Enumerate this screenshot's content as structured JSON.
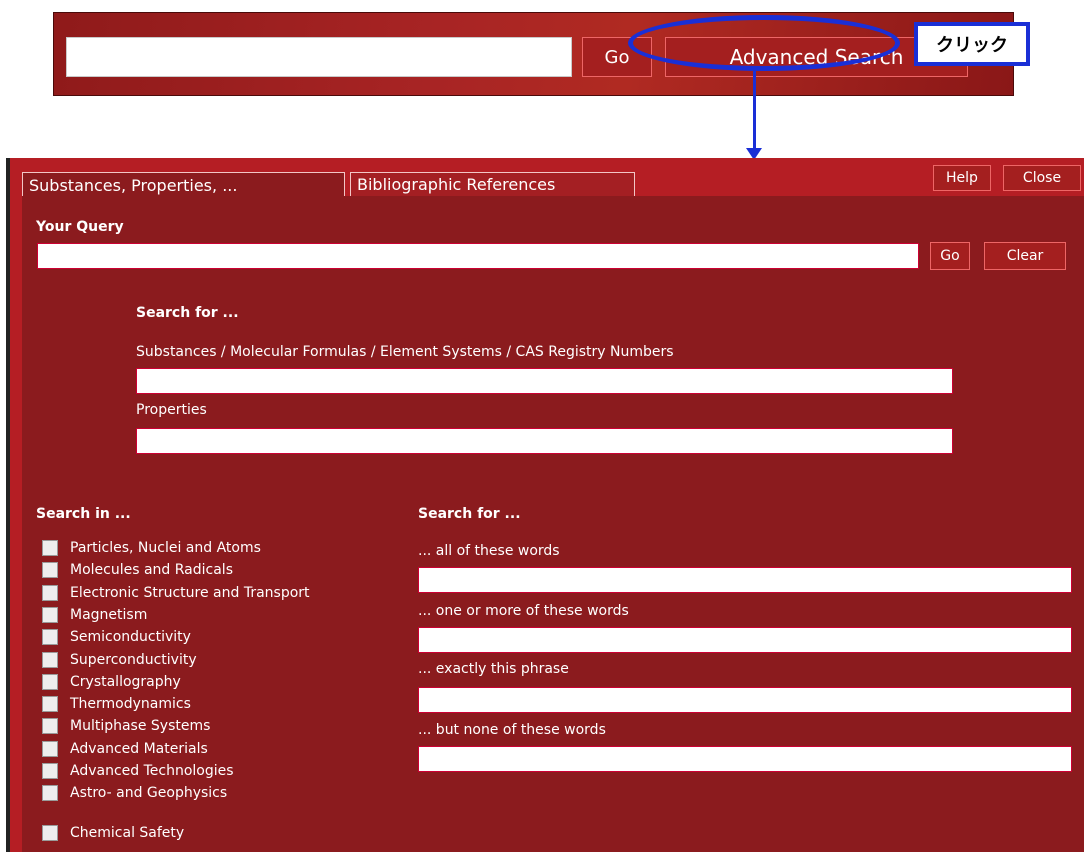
{
  "topbar": {
    "go_label": "Go",
    "advanced_label": "Advanced Search",
    "callout_text": "クリック"
  },
  "panel": {
    "tabs": [
      {
        "label": "Substances, Properties, ..."
      },
      {
        "label": "Bibliographic References"
      }
    ],
    "help_label": "Help",
    "close_label": "Close",
    "your_query_label": "Your Query",
    "query_go_label": "Go",
    "query_clear_label": "Clear",
    "search_for_title": "Search for ...",
    "substances_label": "Substances / Molecular Formulas / Element Systems / CAS Registry Numbers",
    "properties_label": "Properties",
    "search_in_title": "Search in ...",
    "search_for_title_2": "Search for ...",
    "word_fields": [
      {
        "label": "... all of these words"
      },
      {
        "label": "... one or more of these words"
      },
      {
        "label": "... exactly this phrase"
      },
      {
        "label": "... but none of these words"
      }
    ],
    "categories": [
      "Particles, Nuclei and Atoms",
      "Molecules and Radicals",
      "Electronic Structure and Transport",
      "Magnetism",
      "Semiconductivity",
      "Superconductivity",
      "Crystallography",
      "Thermodynamics",
      "Multiphase Systems",
      "Advanced Materials",
      "Advanced Technologies",
      "Astro- and Geophysics"
    ],
    "extra_category": "Chemical Safety"
  },
  "colors": {
    "panel_red": "#8b1b1e",
    "accent_blue": "#1a2fd6"
  }
}
